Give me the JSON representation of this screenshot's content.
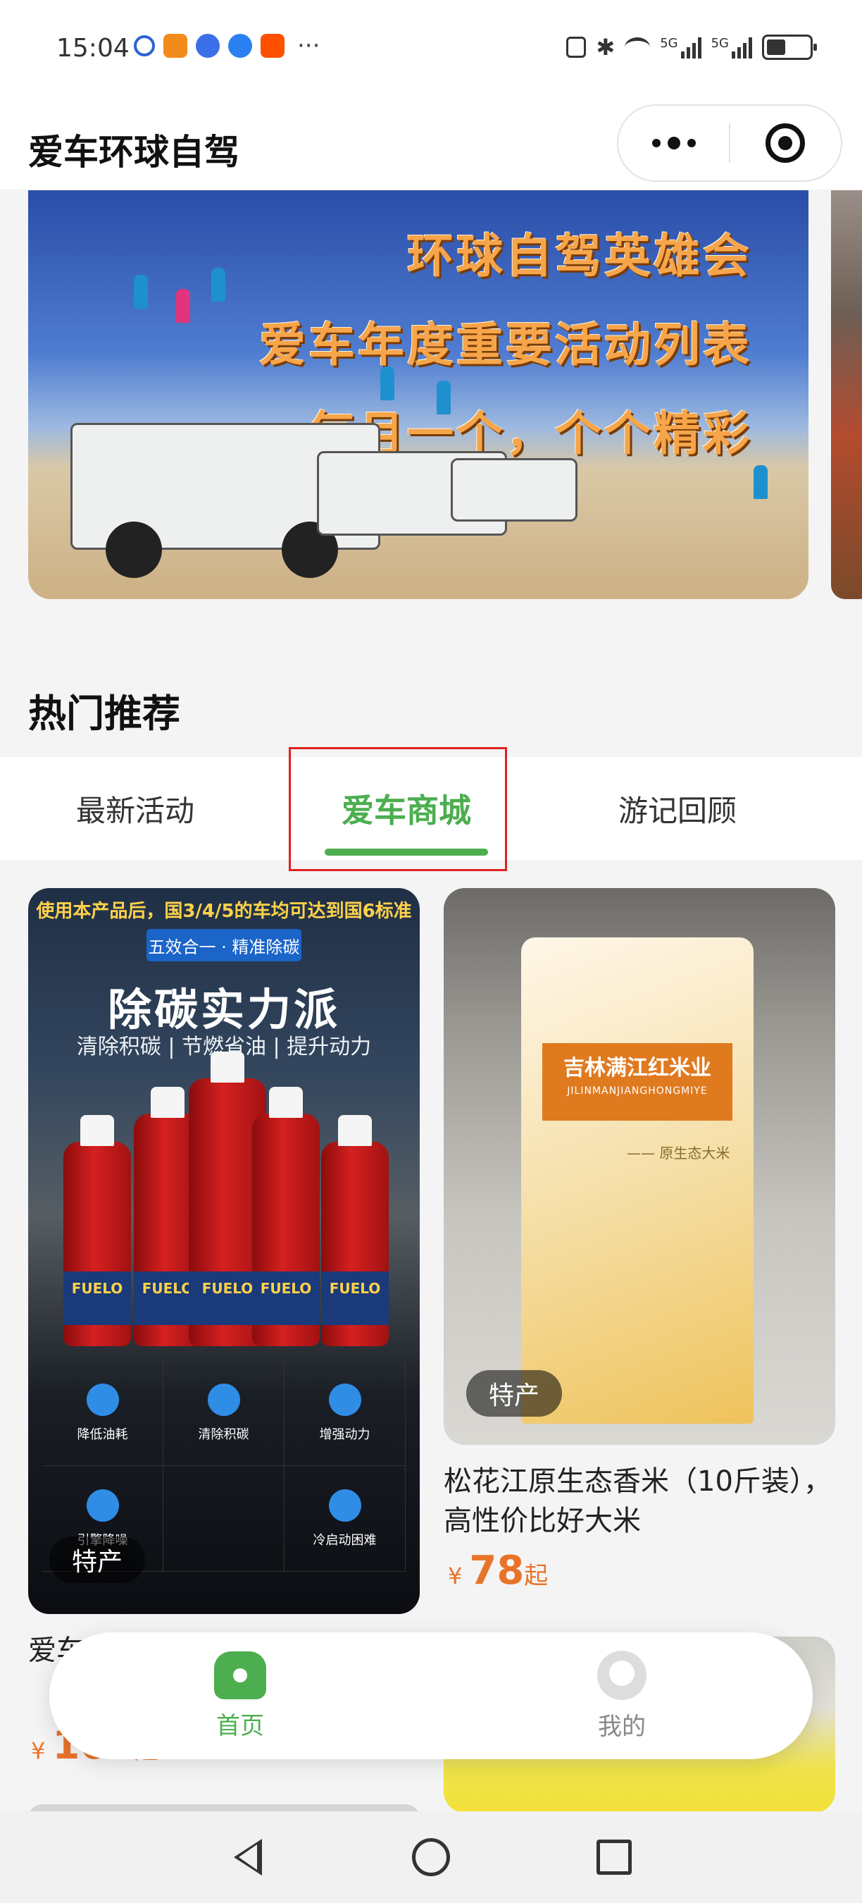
{
  "status_bar": {
    "time": "15:04",
    "more": "···",
    "network_label_1": "5G",
    "network_label_2": "5G",
    "battery_level": 0.45,
    "icons": [
      "nfc-icon",
      "bluetooth-icon",
      "wifi-icon",
      "signal-icon",
      "battery-icon"
    ]
  },
  "nav": {
    "title": "爱车环球自驾",
    "menu_icon": "more-dots-icon",
    "close_icon": "miniprogram-close-icon"
  },
  "banner": {
    "line1": "环球自驾英雄会",
    "line2": "爱车年度重要活动列表",
    "line3": "每月一个，个个精彩"
  },
  "section": {
    "title": "热门推荐"
  },
  "tabs": [
    {
      "label": "最新活动",
      "active": false
    },
    {
      "label": "爱车商城",
      "active": true
    },
    {
      "label": "游记回顾",
      "active": false
    }
  ],
  "products": [
    {
      "poster_top": "使用本产品后，国3/4/5的车均可达到国6标准",
      "poster_tag": "五效合一 · 精准除碳",
      "poster_head": "除碳实力派",
      "poster_sub": "清除积碳 | 节燃省油 | 提升动力",
      "bottle_label": "FUELO",
      "features": [
        "降低油耗",
        "清除积碳",
        "增强动力",
        "引擎降噪",
        "冷启动困难"
      ],
      "badge": "特产",
      "title": "爱车多",
      "price": {
        "currency": "¥",
        "value": "168",
        "suffix": "起"
      }
    },
    {
      "brand": "吉林满江红米业",
      "brand_pinyin": "JILINMANJIANGHONGMIYE",
      "tagline": "—— 原生态大米",
      "badge": "特产",
      "title": "松花江原生态香米（10斤装），高性价比好大米",
      "price": {
        "currency": "¥",
        "value": "78",
        "suffix": "起"
      }
    }
  ],
  "bottom_bar": {
    "items": [
      {
        "label": "首页",
        "icon": "home-icon",
        "active": true
      },
      {
        "label": "我的",
        "icon": "user-icon",
        "active": false
      }
    ]
  },
  "colors": {
    "accent": "#4cae4f",
    "price": "#e8742a",
    "highlight_box": "#e02020"
  }
}
